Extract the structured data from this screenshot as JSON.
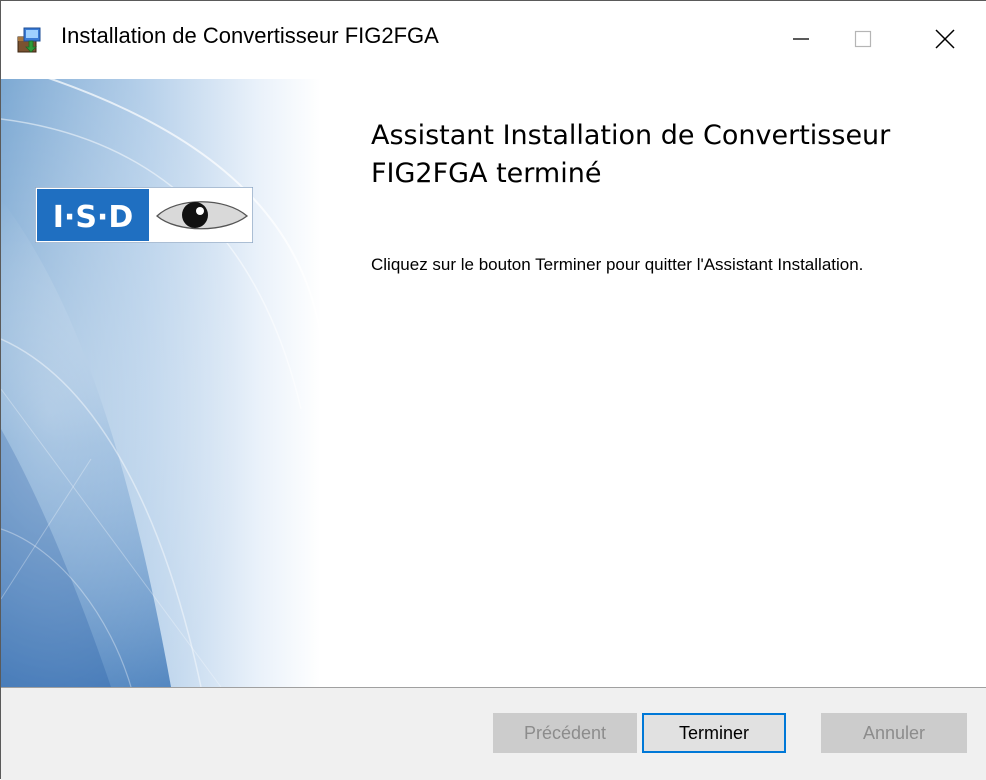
{
  "window": {
    "title": "Installation de Convertisseur FIG2FGA",
    "app_icon": "installer-package-icon",
    "controls": {
      "minimize_icon": "minimize-icon",
      "maximize_icon": "maximize-icon",
      "close_icon": "close-icon"
    }
  },
  "main": {
    "heading": "Assistant Installation de Convertisseur FIG2FGA terminé",
    "instruction": "Cliquez sur le bouton Terminer pour quitter l'Assistant Installation.",
    "logo": {
      "text": "I·S·D",
      "icon": "eye-icon"
    }
  },
  "footer": {
    "back_label": "Précédent",
    "finish_label": "Terminer",
    "cancel_label": "Annuler"
  },
  "colors": {
    "accent": "#0078d7",
    "logo_blue": "#1f6fc1",
    "button_disabled_bg": "#cccccc",
    "footer_bg": "#f0f0f0"
  }
}
